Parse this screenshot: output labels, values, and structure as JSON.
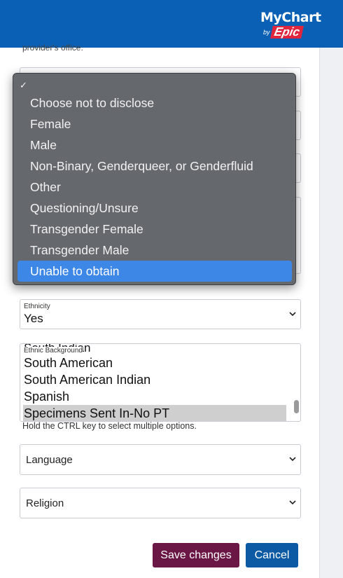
{
  "brand": {
    "name": "MyChart",
    "by": "by",
    "epic": "Epic",
    "color": "#0a60b4"
  },
  "intro_fragment": "provider's office.",
  "dropdown": {
    "checkmark": "✓",
    "options": [
      "Choose not to disclose",
      "Female",
      "Male",
      "Non-Binary, Genderqueer, or Genderfluid",
      "Other",
      "Questioning/Unsure",
      "Transgender Female",
      "Transgender Male",
      "Unable to obtain"
    ],
    "highlighted": "Unable to obtain",
    "highlight_color": "#3d87e7"
  },
  "ethnicity": {
    "label": "Ethnicity",
    "value": "Yes"
  },
  "ethnic_background": {
    "label": "Ethnic Background",
    "cutoff_text": "South Indian",
    "options": [
      "South American",
      "South American Indian",
      "Spanish",
      "Specimens Sent In-No PT"
    ],
    "selected": "Specimens Sent In-No PT"
  },
  "hint": "Hold the CTRL key to select multiple options.",
  "language": {
    "placeholder": "Language"
  },
  "religion": {
    "placeholder": "Religion"
  },
  "buttons": {
    "save": "Save changes",
    "cancel": "Cancel",
    "save_color": "#6b1746",
    "cancel_color": "#0b5aa3"
  }
}
